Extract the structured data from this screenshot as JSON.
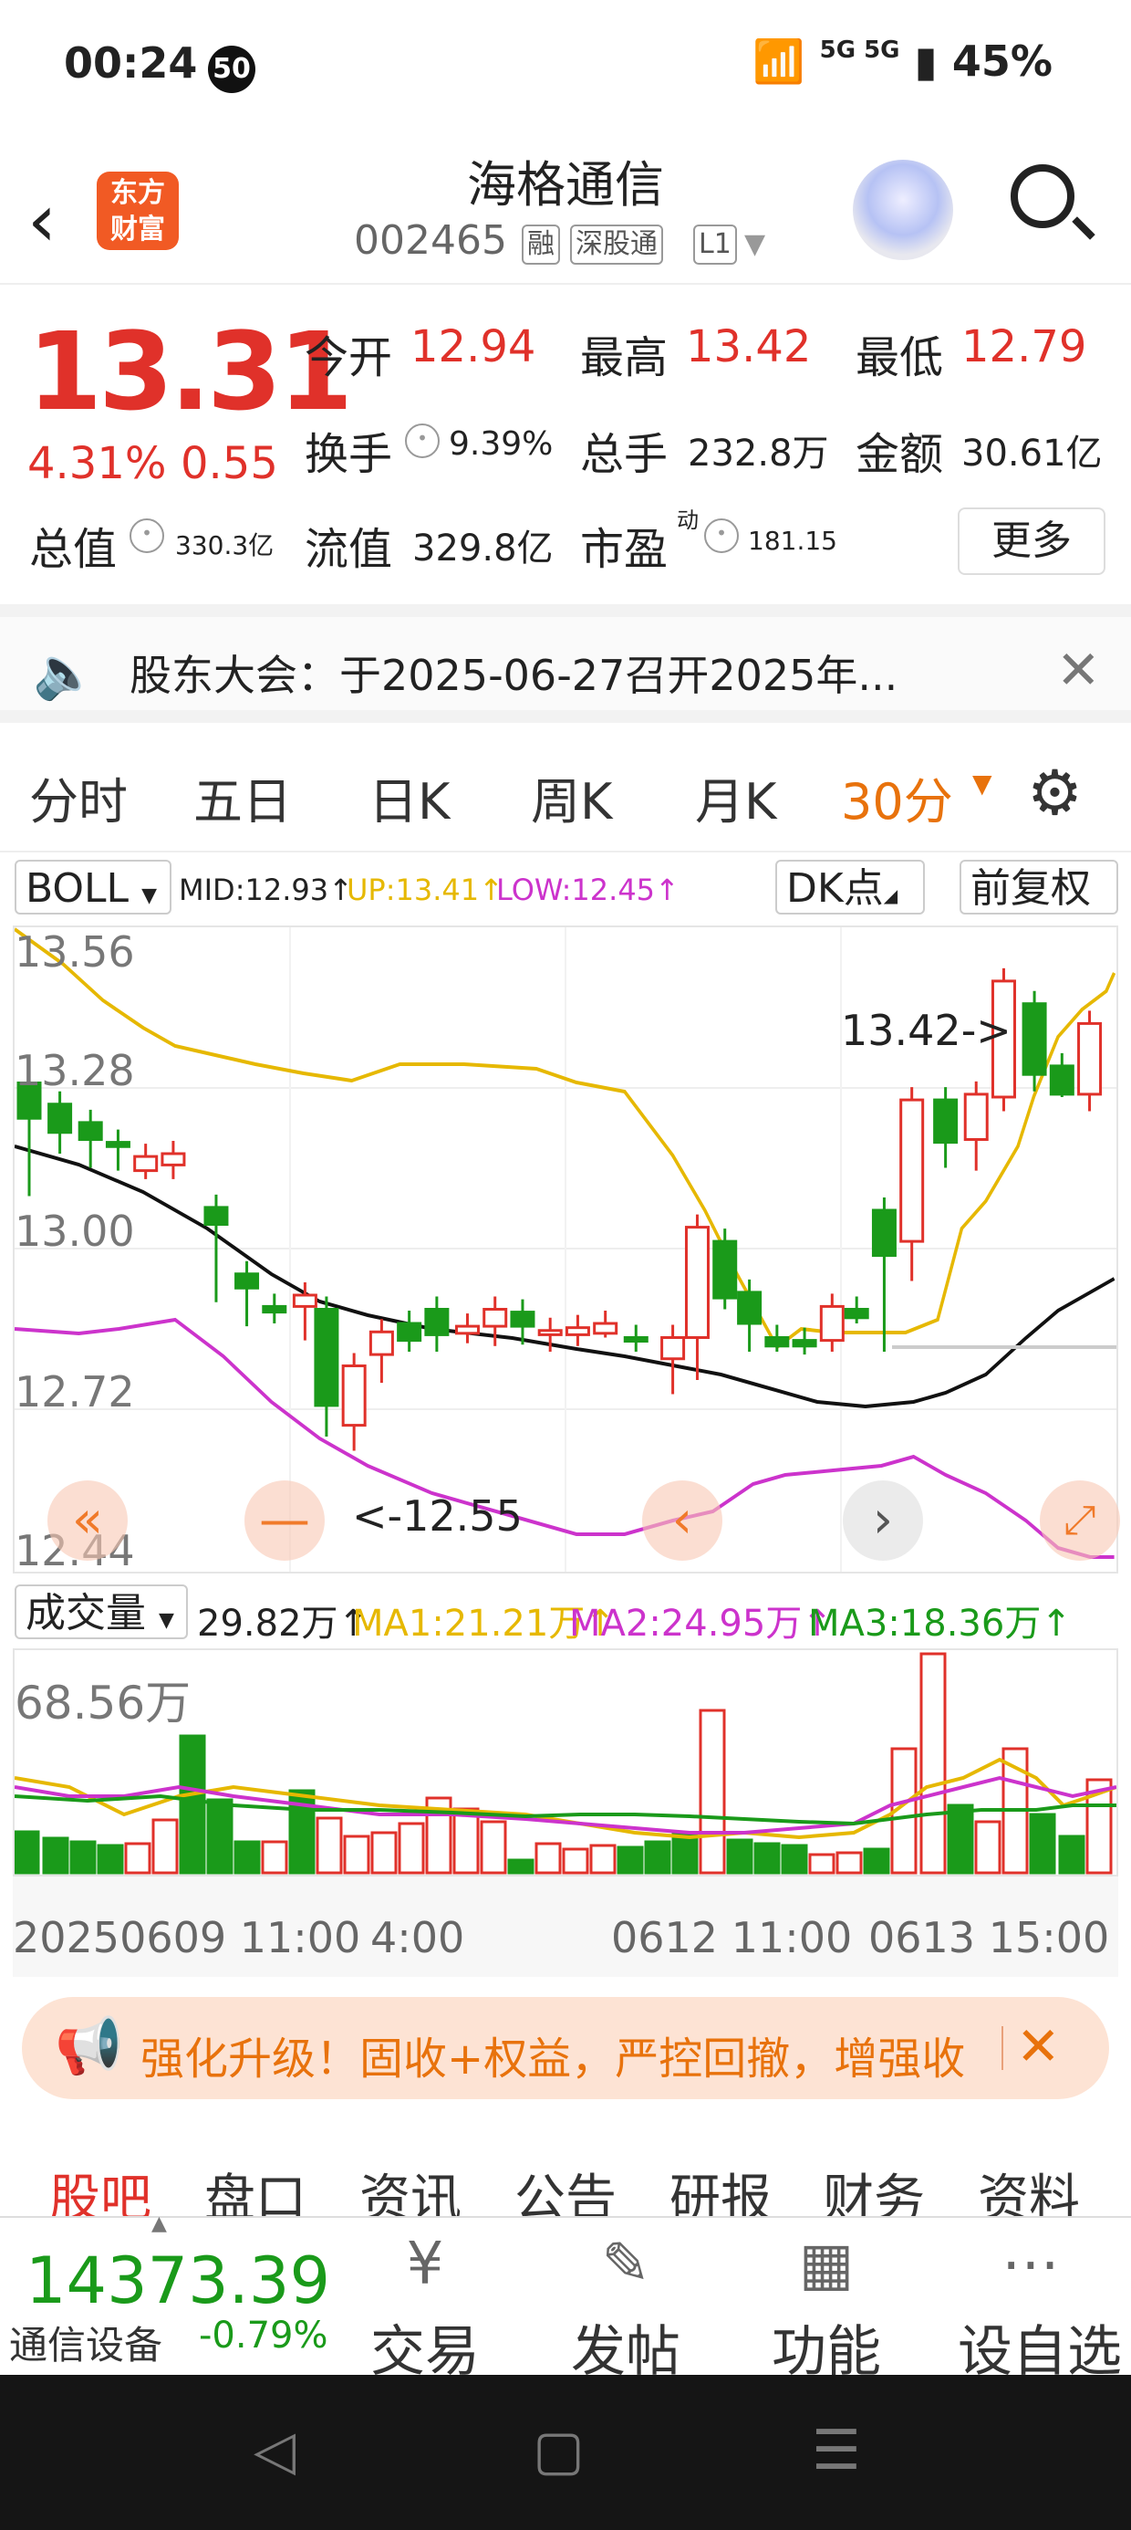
{
  "status_bar": {
    "time": "00:24",
    "notif_badge": "50",
    "network": "5G 5G",
    "battery": "45%"
  },
  "header": {
    "title": "海格通信",
    "code": "002465",
    "tags": [
      "融",
      "深股通",
      "L1"
    ],
    "logo_text_1": "东方",
    "logo_text_2": "财富"
  },
  "quote": {
    "price": "13.31",
    "change_pct": "4.31%",
    "change_abs": "0.55",
    "open_label": "今开",
    "open": "12.94",
    "high_label": "最高",
    "high": "13.42",
    "low_label": "最低",
    "low": "12.79",
    "turnover_label": "换手",
    "turnover": "9.39%",
    "volume_label": "总手",
    "volume": "232.8万",
    "amount_label": "金额",
    "amount": "30.61亿",
    "mcap_label": "总值",
    "mcap": "330.3亿",
    "float_label": "流值",
    "float_cap": "329.8亿",
    "pe_label": "市盈",
    "pe_sup": "动",
    "pe": "181.15",
    "more_button": "更多"
  },
  "notice": {
    "text": "股东大会：于2025-06-27召开2025年..."
  },
  "period_tabs": [
    "分时",
    "五日",
    "日K",
    "周K",
    "月K",
    "30分"
  ],
  "indicator": {
    "name": "BOLL",
    "mid": "MID:12.93↑",
    "up": "UP:13.41↑",
    "low": "LOW:12.45↑",
    "dk": "DK点",
    "adjust": "前复权"
  },
  "kchart": {
    "y_labels": [
      "13.56",
      "13.28",
      "13.00",
      "12.72",
      "12.44"
    ],
    "max_annot": "13.42->",
    "min_annot": "<-12.55"
  },
  "volume": {
    "label": "成交量",
    "value": "29.82万↑",
    "ma1": "MA1:21.21万↑",
    "ma2": "MA2:24.95万↑",
    "ma3": "MA3:18.36万↑",
    "y_label": "68.56万"
  },
  "dates": [
    "20250609 11:00",
    "4:00",
    "0612 11:00",
    "0613 15:00"
  ],
  "ad": {
    "text": "强化升级！固收+权益，严控回撤，增强收"
  },
  "bottom_tabs": [
    "股吧",
    "盘口",
    "资讯",
    "公告",
    "研报",
    "财务",
    "资料"
  ],
  "footer": {
    "index_value": "14373.39",
    "index_name": "通信设备",
    "index_change": "-0.79%",
    "buttons": [
      "交易",
      "发帖",
      "功能",
      "设自选"
    ]
  },
  "colors": {
    "up": "#e0312a",
    "down": "#1a9a1a",
    "accent": "#e8720c",
    "ma1": "#e6b800",
    "ma2": "#cc33cc",
    "ma3": "#1a9a1a"
  }
}
